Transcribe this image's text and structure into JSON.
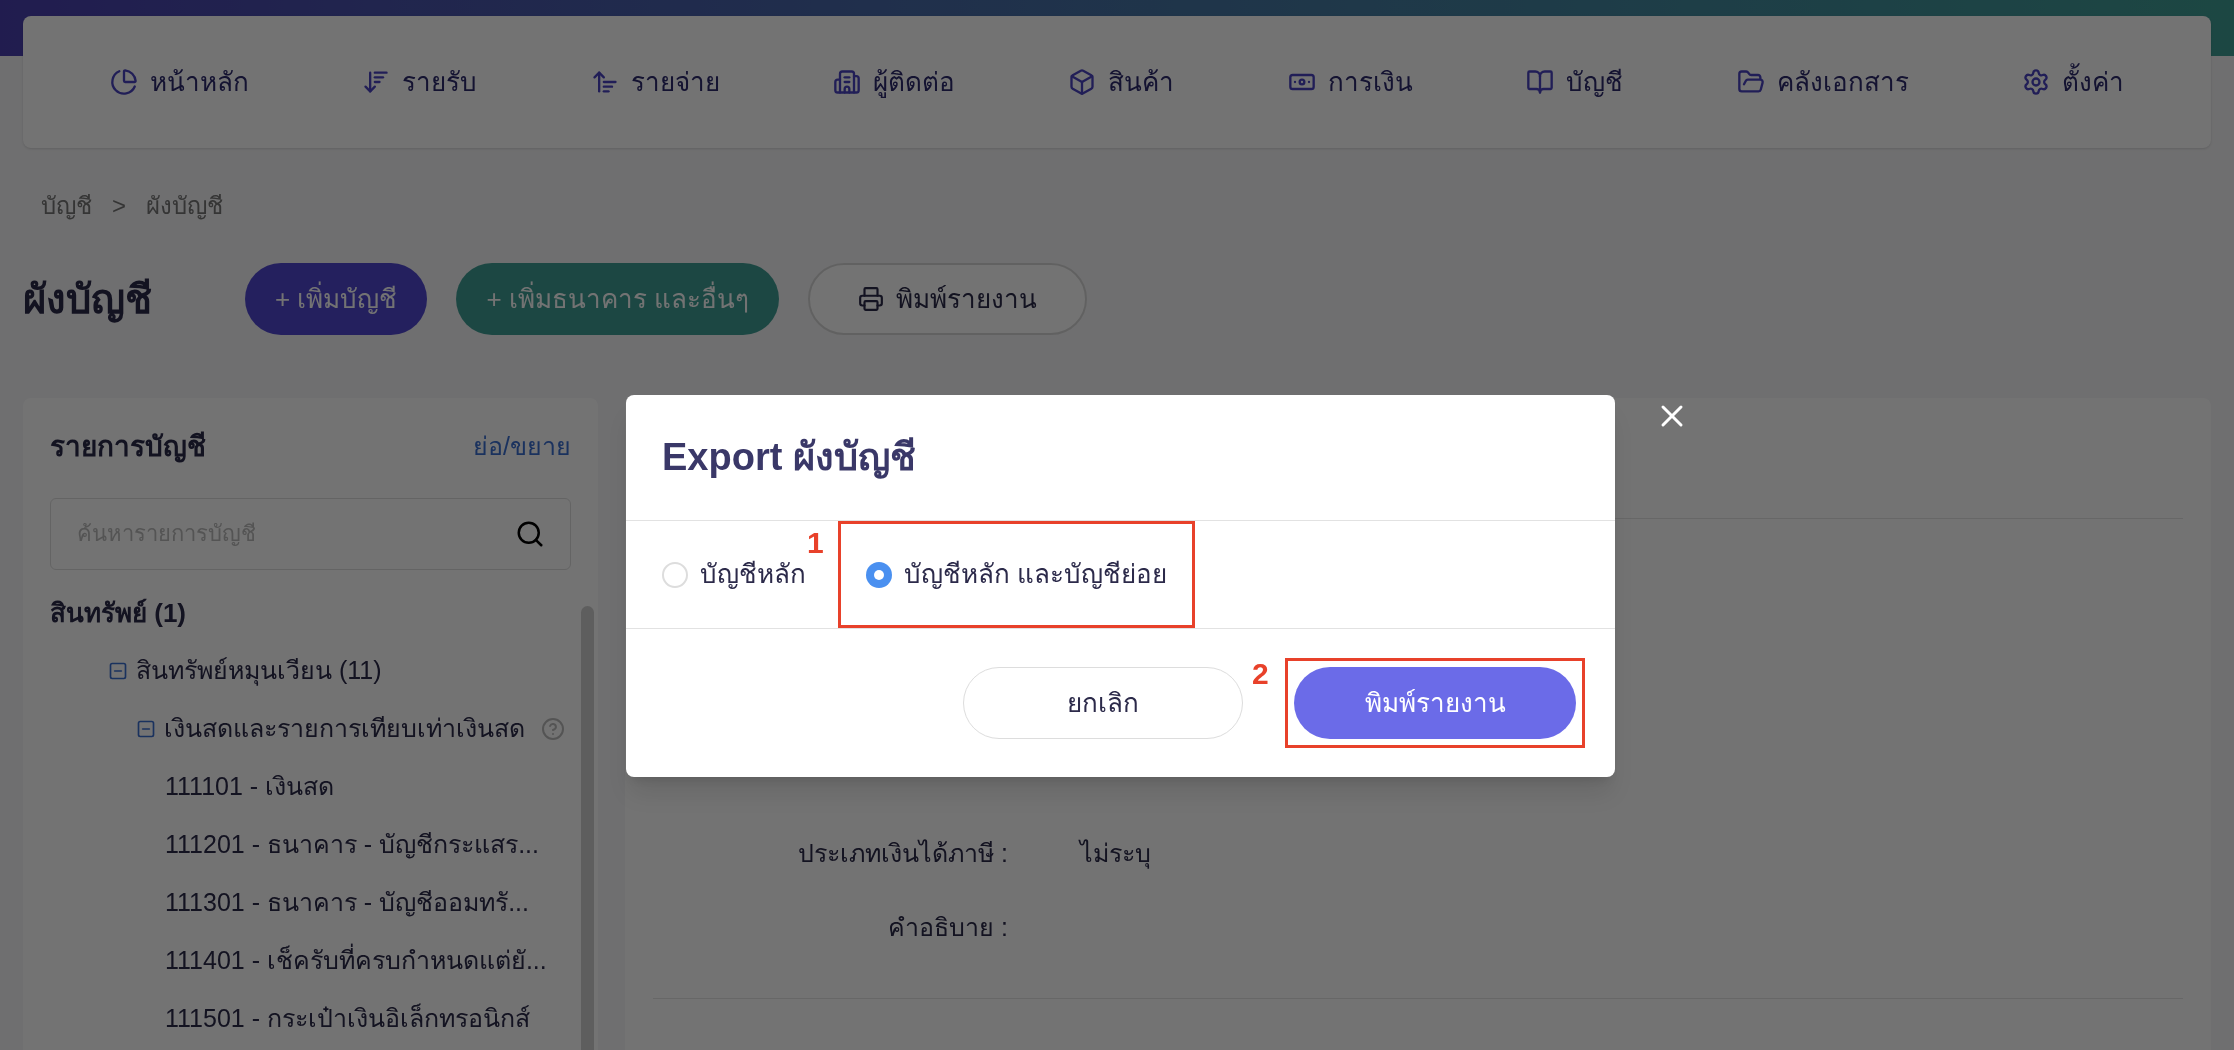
{
  "top_nav": {
    "items": [
      {
        "label": "หน้าหลัก"
      },
      {
        "label": "รายรับ"
      },
      {
        "label": "รายจ่าย"
      },
      {
        "label": "ผู้ติดต่อ"
      },
      {
        "label": "สินค้า"
      },
      {
        "label": "การเงิน"
      },
      {
        "label": "บัญชี"
      },
      {
        "label": "คลังเอกสาร"
      },
      {
        "label": "ตั้งค่า"
      }
    ]
  },
  "breadcrumb": {
    "items": [
      "บัญชี",
      "ผังบัญชี"
    ],
    "separator": ">"
  },
  "page": {
    "title": "ผังบัญชี",
    "buttons": [
      {
        "label": "+ เพิ่มบัญชี",
        "kind": "primary"
      },
      {
        "label": "+ เพิ่มธนาคาร และอื่นๆ",
        "kind": "secondary"
      },
      {
        "label": "พิมพ์รายงาน",
        "kind": "outline"
      }
    ]
  },
  "account_list": {
    "title": "รายการบัญชี",
    "toggle_link": "ย่อ/ขยาย",
    "search": {
      "placeholder": "ค้นหารายการบัญชี"
    },
    "tree": [
      {
        "label": "สินทรัพย์ (1)",
        "children": [
          {
            "label": "สินทรัพย์หมุนเวียน (11)",
            "expanded": true,
            "children": [
              {
                "label": "เงินสดและรายการเทียบเท่าเงินสด",
                "expanded": true,
                "help": true,
                "children": [
                  {
                    "label": "111101 - เงินสด"
                  },
                  {
                    "label": "111201 - ธนาคาร - บัญชีกระแสร..."
                  },
                  {
                    "label": "111301 - ธนาคาร - บัญชีออมทรั..."
                  },
                  {
                    "label": "111401 - เช็ครับที่ครบกำหนดแต่ยั..."
                  },
                  {
                    "label": "111501 - กระเป๋าเงินอิเล็กทรอนิกส์"
                  }
                ]
              }
            ]
          }
        ]
      }
    ]
  },
  "detail": {
    "fields": [
      {
        "label": "ประเภทเงินได้ภาษี :",
        "value": "ไม่ระบุ"
      },
      {
        "label": "คำอธิบาย :"
      }
    ]
  },
  "modal": {
    "title": "Export ผังบัญชี",
    "options": [
      {
        "label": "บัญชีหลัก",
        "selected": false
      },
      {
        "label": "บัญชีหลัก และบัญชีย่อย",
        "selected": true
      }
    ],
    "cancel": "ยกเลิก",
    "confirm": "พิมพ์รายงาน"
  },
  "annotations": [
    {
      "label": "1"
    },
    {
      "label": "2"
    }
  ]
}
